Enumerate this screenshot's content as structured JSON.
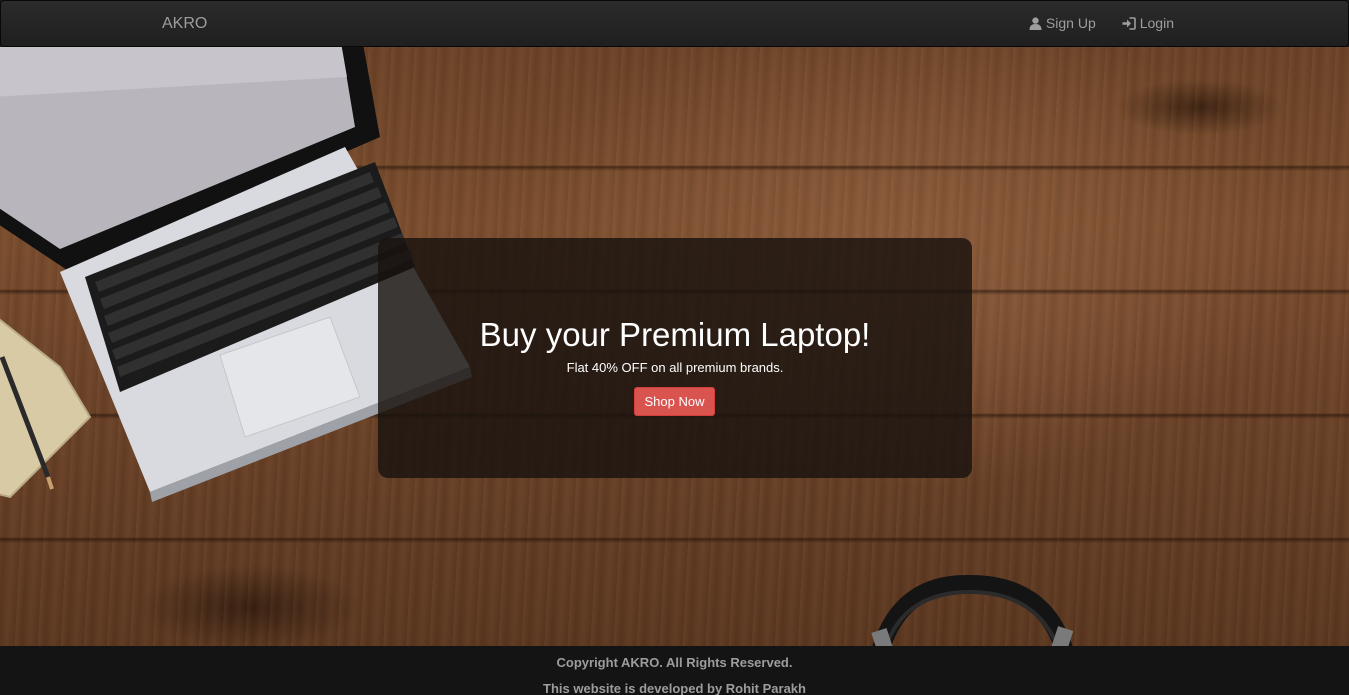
{
  "navbar": {
    "brand": "AKRO",
    "links": [
      {
        "label": "Sign Up",
        "icon": "user-icon"
      },
      {
        "label": "Login",
        "icon": "login-icon"
      }
    ]
  },
  "hero": {
    "title": "Buy your Premium Laptop!",
    "subtitle": "Flat 40% OFF on all premium brands.",
    "button_label": "Shop Now"
  },
  "footer": {
    "copyright": "Copyright AKRO. All Rights Reserved.",
    "developer": "This website is developed by Rohit Parakh"
  },
  "colors": {
    "navbar_bg": "#222222",
    "nav_text": "#9d9d9d",
    "button_danger": "#d9534f",
    "footer_bg": "#141414"
  }
}
